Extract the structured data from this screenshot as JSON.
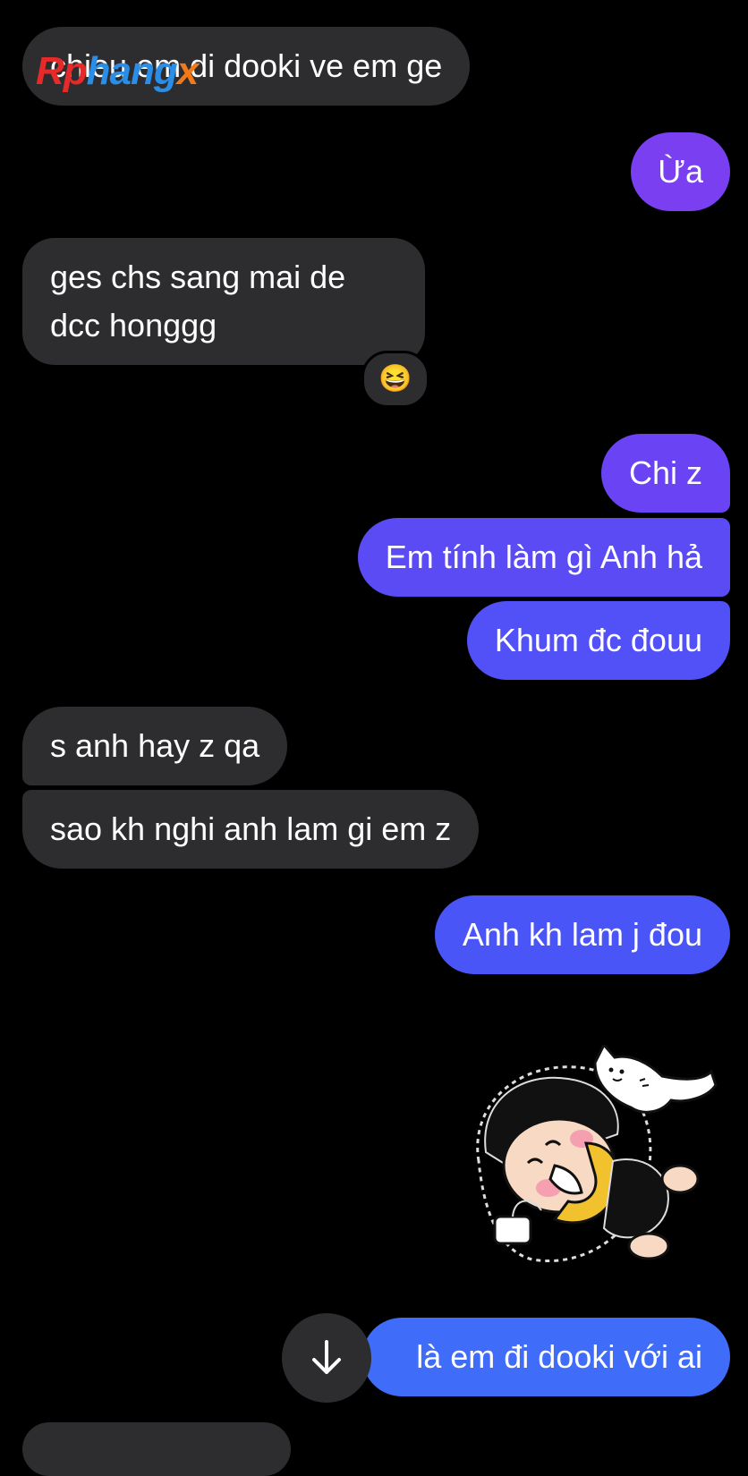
{
  "messages": {
    "m1": "chieu em di dooki  ve em ge",
    "m2": "Ừa",
    "m3": "ges chs sang mai de dcc honggg",
    "m4": "Chi z",
    "m5": "Em tính làm gì Anh hả",
    "m6": "Khum đc đouu",
    "m7": "s anh hay z qa",
    "m8": "sao kh nghi anh lam gi em z",
    "m9": "Anh kh lam j đou",
    "m10": "là em đi dooki với ai"
  },
  "reaction": {
    "emoji": "😆",
    "icon": "grinning-squinting-face-emoji"
  },
  "watermark": {
    "part1": "Rp",
    "part2": "hang",
    "part3": "x"
  },
  "scroll_button": {
    "icon": "arrow-down-icon"
  },
  "sticker": {
    "icon": "sleeping-child-and-cat-sticker"
  },
  "colors": {
    "background": "#000000",
    "incoming_bubble": "#2d2d2f",
    "outgoing_purple": "#7b3ff2",
    "outgoing_indigo": "#5b4bf5",
    "outgoing_blue": "#4a55f8",
    "outgoing_brightblue": "#3f6cf9"
  }
}
